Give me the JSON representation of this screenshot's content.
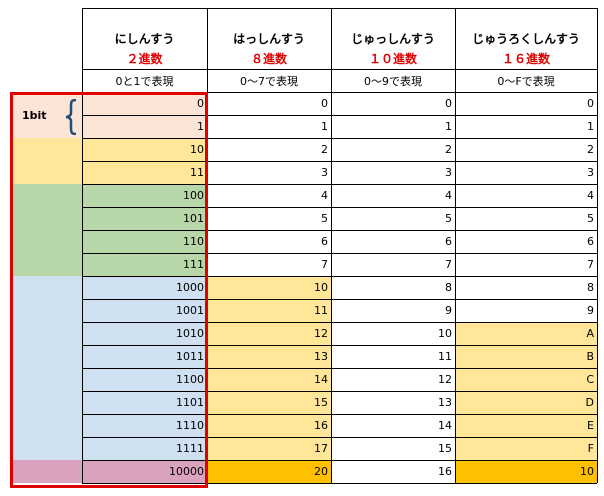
{
  "columns": [
    {
      "name": "にしんすう",
      "base": "２進数",
      "range": "0と1で表現"
    },
    {
      "name": "はっしんすう",
      "base": "８進数",
      "range": "0～7で表現"
    },
    {
      "name": "じゅっしんすう",
      "base": "１０進数",
      "range": "0～9で表現"
    },
    {
      "name": "じゅうろくしんすう",
      "base": "１６進数",
      "range": "0～Fで表現"
    }
  ],
  "bit_label": "1bit",
  "rows": [
    {
      "bin": "0",
      "oct": "0",
      "dec": "0",
      "hex": "0"
    },
    {
      "bin": "1",
      "oct": "1",
      "dec": "1",
      "hex": "1"
    },
    {
      "bin": "10",
      "oct": "2",
      "dec": "2",
      "hex": "2"
    },
    {
      "bin": "11",
      "oct": "3",
      "dec": "3",
      "hex": "3"
    },
    {
      "bin": "100",
      "oct": "4",
      "dec": "4",
      "hex": "4"
    },
    {
      "bin": "101",
      "oct": "5",
      "dec": "5",
      "hex": "5"
    },
    {
      "bin": "110",
      "oct": "6",
      "dec": "6",
      "hex": "6"
    },
    {
      "bin": "111",
      "oct": "7",
      "dec": "7",
      "hex": "7"
    },
    {
      "bin": "1000",
      "oct": "10",
      "dec": "8",
      "hex": "8"
    },
    {
      "bin": "1001",
      "oct": "11",
      "dec": "9",
      "hex": "9"
    },
    {
      "bin": "1010",
      "oct": "12",
      "dec": "10",
      "hex": "A"
    },
    {
      "bin": "1011",
      "oct": "13",
      "dec": "11",
      "hex": "B"
    },
    {
      "bin": "1100",
      "oct": "14",
      "dec": "12",
      "hex": "C"
    },
    {
      "bin": "1101",
      "oct": "15",
      "dec": "13",
      "hex": "D"
    },
    {
      "bin": "1110",
      "oct": "16",
      "dec": "14",
      "hex": "E"
    },
    {
      "bin": "1111",
      "oct": "17",
      "dec": "15",
      "hex": "F"
    },
    {
      "bin": "10000",
      "oct": "20",
      "dec": "16",
      "hex": "10"
    }
  ],
  "colors": {
    "peach": "#fce4d6",
    "yellow": "#ffe699",
    "green": "#b7d7a8",
    "blue": "#cfe0f1",
    "pink": "#d9a2bf",
    "orange": "#ffc000",
    "highlight_red": "#e00000",
    "brace_blue": "#1f4e79"
  }
}
